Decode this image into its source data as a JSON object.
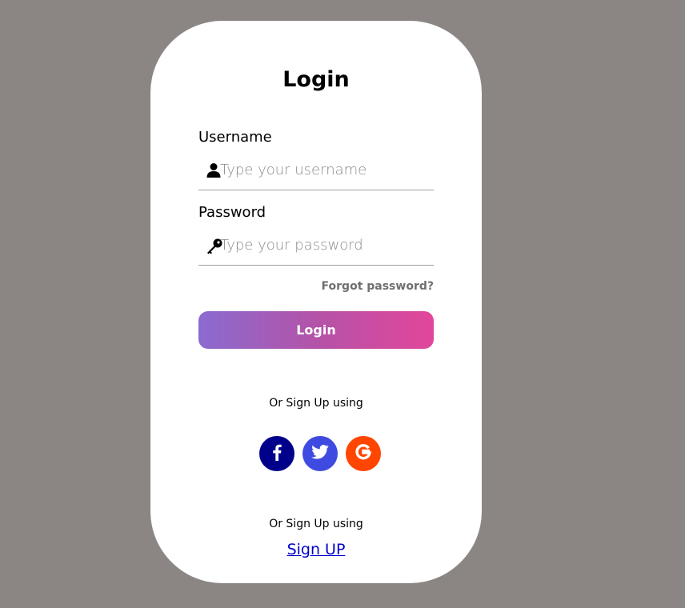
{
  "login": {
    "title": "Login",
    "username_label": "Username",
    "username_placeholder": "Type your username",
    "password_label": "Password",
    "password_placeholder": "Type your password",
    "forgot_password": "Forgot password?",
    "login_button": "Login"
  },
  "social": {
    "prompt": "Or Sign Up using",
    "items": [
      {
        "name": "facebook-icon",
        "color": "#00008b"
      },
      {
        "name": "twitter-icon",
        "color": "#3f4ae0"
      },
      {
        "name": "google-icon",
        "color": "#ff4500"
      }
    ]
  },
  "signup": {
    "prompt": "Or Sign Up using",
    "link": "Sign UP"
  }
}
